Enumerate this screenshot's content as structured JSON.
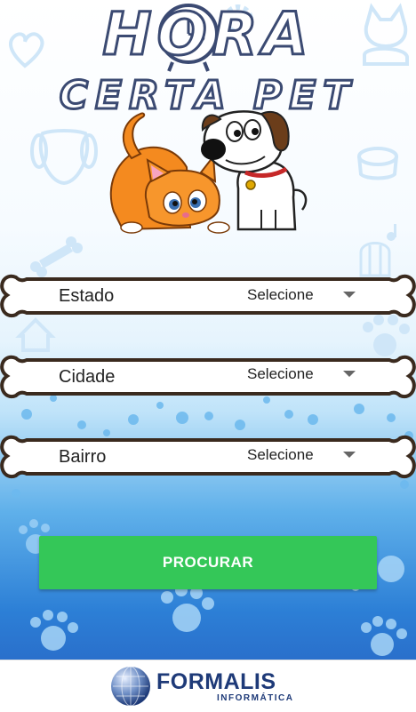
{
  "app": {
    "title_line1": "HORA",
    "title_line2": "CERTA PET"
  },
  "form": {
    "fields": [
      {
        "label": "Estado",
        "value": "Selecione"
      },
      {
        "label": "Cidade",
        "value": "Selecione"
      },
      {
        "label": "Bairro",
        "value": "Selecione"
      }
    ],
    "search_button": "PROCURAR"
  },
  "footer": {
    "brand": "FORMALIS",
    "subtitle": "INFORMÁTICA"
  },
  "colors": {
    "button": "#34c758",
    "brand": "#1e3a78",
    "title_outline": "#3b4a72",
    "bone_outline": "#3a2a1e"
  },
  "icons": [
    "heart-icon",
    "cat-icon",
    "dog-face-icon",
    "pet-bowl-icon",
    "bone-icon",
    "birdcage-icon",
    "music-note-icon",
    "doghouse-icon",
    "paw-icon",
    "clock-icon",
    "gear-icon",
    "globe-icon",
    "caret-down-icon"
  ]
}
